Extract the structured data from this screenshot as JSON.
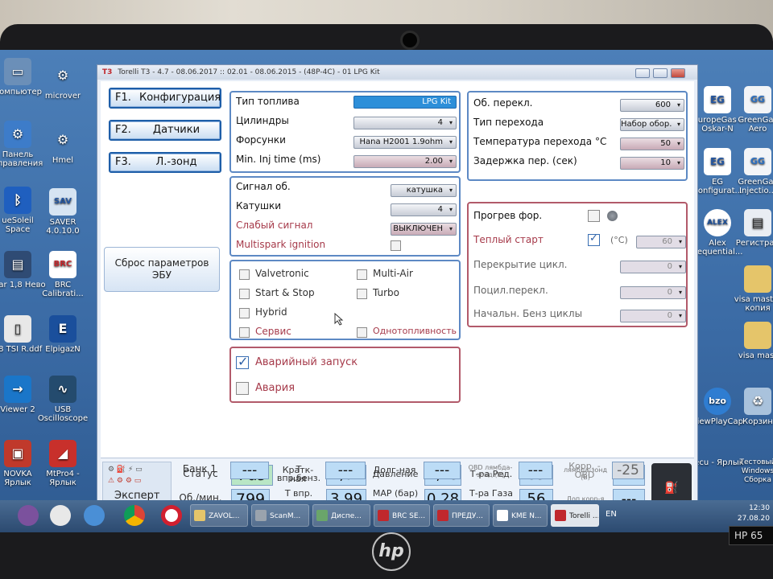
{
  "window": {
    "title_mark": "T3",
    "title": "Torelli T3 - 4.7 - 08.06.2017 :: 02.01 - 08.06.2015 - (48P-4C) - 01 LPG Kit"
  },
  "nav": {
    "f1": {
      "key": "F1.",
      "label": "Конфигурация"
    },
    "f2": {
      "key": "F2.",
      "label": "Датчики"
    },
    "f3": {
      "key": "F3.",
      "label": "Л.-зонд"
    },
    "reset_label": "Сброс параметров ЭБУ"
  },
  "fuel_panel": {
    "fuel_type_label": "Тип топлива",
    "fuel_type_value": "LPG Kit",
    "cylinders_label": "Цилиндры",
    "cylinders_value": "4",
    "injectors_label": "Форсунки",
    "injectors_value": "Hana H2001 1.9ohm",
    "min_inj_label": "Min. Inj time (ms)",
    "min_inj_value": "2.00"
  },
  "signal_panel": {
    "signal_label": "Сигнал об.",
    "signal_value": "катушка",
    "coils_label": "Катушки",
    "coils_value": "4",
    "weak_label": "Слабый сигнал",
    "weak_value": "ВЫКЛЮЧЕН",
    "multispark_label": "Multispark ignition"
  },
  "options_panel": {
    "valvetronic": "Valvetronic",
    "multiair": "Multi-Air",
    "startstop": "Start & Stop",
    "turbo": "Turbo",
    "hybrid": "Hybrid",
    "service": "Сервис",
    "monofuel": "Однотопливность"
  },
  "emergency_panel": {
    "emergency_start": "Аварийный запуск",
    "alarm": "Авария"
  },
  "switch_panel": {
    "rpm_label": "Об. перекл.",
    "rpm_value": "600",
    "type_label": "Тип перехода",
    "type_value": "Набор обор.",
    "temp_label": "Температура перехода °C",
    "temp_value": "50",
    "delay_label": "Задержка пер. (сек)",
    "delay_value": "10"
  },
  "warmup_panel": {
    "warmup_label": "Прогрев фор.",
    "hotstart_label": "Теплый старт",
    "hotstart_unit": "(°C)",
    "hotstart_value": "60",
    "overlap_label": "Перекрытие цикл.",
    "overlap_value": "0",
    "phased_label": "Поцил.перекл.",
    "phased_value": "0",
    "initpetrol_label": "Начальн. Бенз циклы",
    "initpetrol_value": "0"
  },
  "statusbar": {
    "mode_label": "Эксперт",
    "status_label": "Статус",
    "status_value": "Газ",
    "t_petrol_label": "Т впр.бенз.",
    "t_petrol_value": "2,61",
    "pressure_label": "Давление",
    "pressure_value": "1,43",
    "t_reducer_label": "Т-ра Ред.",
    "t_reducer_value": "83",
    "lambda_label": "лямбда-зонд (В)",
    "lambda_value": "---",
    "rpm_label": "Об./мин.",
    "rpm_value": "799",
    "t_gas_label": "Т впр. газ",
    "t_gas_value": "3,99",
    "map_label": "MAP (бар)",
    "map_value": "0,28",
    "t_gas_temp_label": "Т-ра Газа",
    "t_gas_temp_value": "56",
    "addcorr_label": "Доп.корр-я",
    "addcorr_value": "---",
    "bank_label": "Банк 1",
    "bank_value": "---",
    "short_label": "Кратк-ная",
    "short_value": "---",
    "long_label": "Долг-ная",
    "long_value": "---",
    "obd_lambda_label": "OBD лямбда-зонд (В)",
    "obd_lambda_value": "---",
    "obd_corr_label": "Корр. -OBD",
    "obd_corr_value": "-25"
  },
  "desktop": {
    "left_icons": [
      "Компьютер",
      "Панель управления",
      "ueSoleil Space",
      "ccar 1,8 Нево",
      "18 TSI R.ddf",
      "Viewer 2",
      "NOVKA Ярлык"
    ],
    "left2_icons": [
      "microver",
      "Hmel",
      "SAVER 4.0.10.0",
      "BRC Calibrati...",
      "ElpigazN",
      "USB Oscilloscope",
      "MtPro4 - Ярлык"
    ],
    "right_icons": [
      "EuropeGas - Oskar-N",
      "GreenGas Aero",
      "EG Configurat...",
      "GreenGas Injectio...",
      "Alex Sequential...",
      "Регистрац",
      "visa master копия",
      "visa mast",
      "ViewPlayCap",
      "Корзин",
      "tecu - Ярлык",
      "Тестовый Windows Сборка"
    ]
  },
  "taskbar": {
    "items": [
      "ZAVOL...",
      "ScanM...",
      "Диспе...",
      "BRC SE...",
      "ПРЕДУ...",
      "KME N...",
      "Torelli ..."
    ],
    "lang": "EN",
    "time": "12:30",
    "date": "27.08.20"
  },
  "device": {
    "brand": "hp",
    "model": "HP 65"
  }
}
